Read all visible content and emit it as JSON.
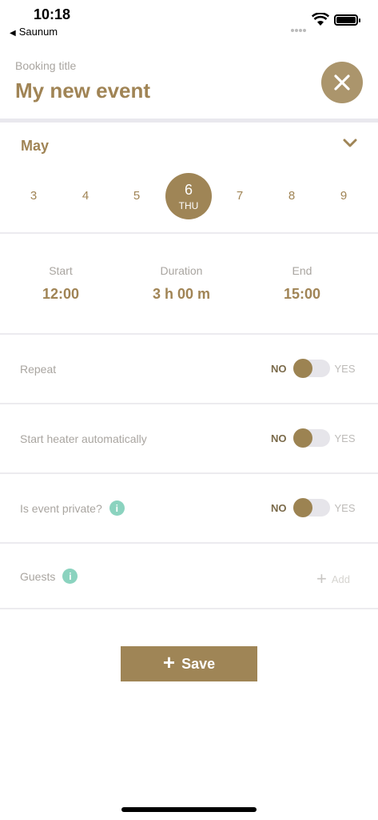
{
  "status": {
    "time": "10:18",
    "back_app": "Saunum"
  },
  "header": {
    "booking_label": "Booking title",
    "title": "My new event",
    "close_icon": "close-icon"
  },
  "calendar": {
    "month": "May",
    "days": [
      {
        "num": "3"
      },
      {
        "num": "4"
      },
      {
        "num": "5"
      },
      {
        "num": "6",
        "weekday": "THU",
        "selected": true
      },
      {
        "num": "7"
      },
      {
        "num": "8"
      },
      {
        "num": "9"
      }
    ]
  },
  "times": {
    "start_label": "Start",
    "start_value": "12:00",
    "duration_label": "Duration",
    "duration_value": "3 h 00 m",
    "end_label": "End",
    "end_value": "15:00"
  },
  "settings": {
    "repeat": {
      "label": "Repeat",
      "no": "NO",
      "yes": "YES",
      "value": false
    },
    "heater": {
      "label": "Start heater automatically",
      "no": "NO",
      "yes": "YES",
      "value": false
    },
    "private": {
      "label": "Is event private?",
      "no": "NO",
      "yes": "YES",
      "value": false
    }
  },
  "guests": {
    "label": "Guests",
    "add_label": "Add"
  },
  "save_label": "Save",
  "colors": {
    "accent": "#9f8556",
    "info": "#8bd3bf"
  }
}
